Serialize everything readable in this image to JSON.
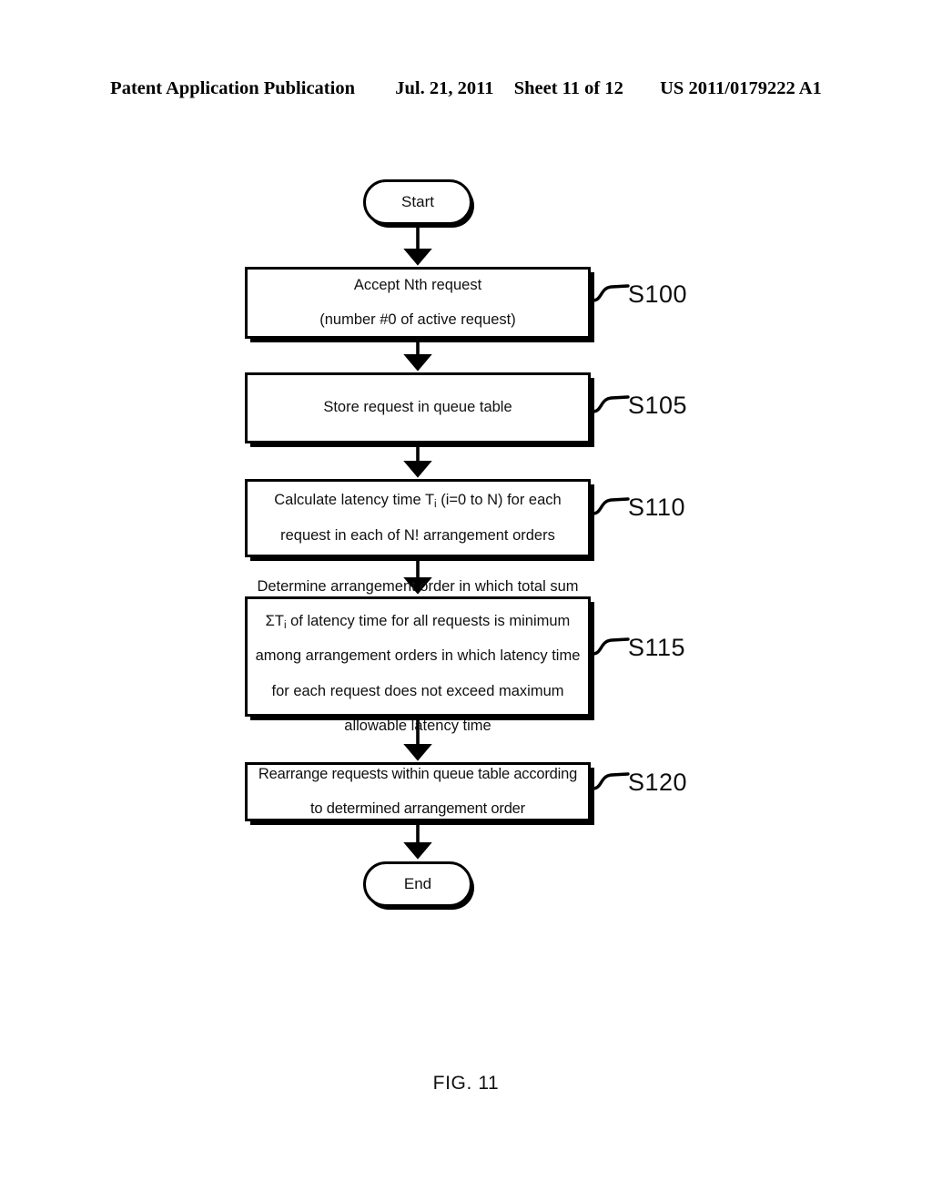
{
  "header": {
    "publication": "Patent Application Publication",
    "date": "Jul. 21, 2011",
    "sheet": "Sheet 11 of 12",
    "number": "US 2011/0179222 A1"
  },
  "figure": {
    "caption": "FIG. 11",
    "type": "flowchart"
  },
  "flowchart": {
    "start_node": {
      "label": "Start",
      "shape": "terminator"
    },
    "end_node": {
      "label": "End",
      "shape": "terminator"
    },
    "steps": [
      {
        "ref": "S100",
        "line1": "Accept Nth request",
        "line2": "(number #0 of active request)"
      },
      {
        "ref": "S105",
        "line1": "Store request in queue table",
        "line2": ""
      },
      {
        "ref": "S110",
        "line1_a": "Calculate latency time T",
        "line1_sub": "i",
        "line1_b": " (i=0 to N) for each",
        "line2": "request in each of N! arrangement orders"
      },
      {
        "ref": "S115",
        "line1": "Determine arrangement order in which total sum",
        "line2_a": "ΣT",
        "line2_sub": "i",
        "line2_b": " of latency time for all requests is minimum",
        "line3": "among arrangement orders in which latency time",
        "line4": "for each request does not exceed maximum",
        "line5": "allowable latency time"
      },
      {
        "ref": "S120",
        "line1": "Rearrange requests within queue table according",
        "line2": "to determined arrangement order"
      }
    ]
  },
  "colors": {
    "ink": "#000000",
    "paper": "#ffffff"
  }
}
